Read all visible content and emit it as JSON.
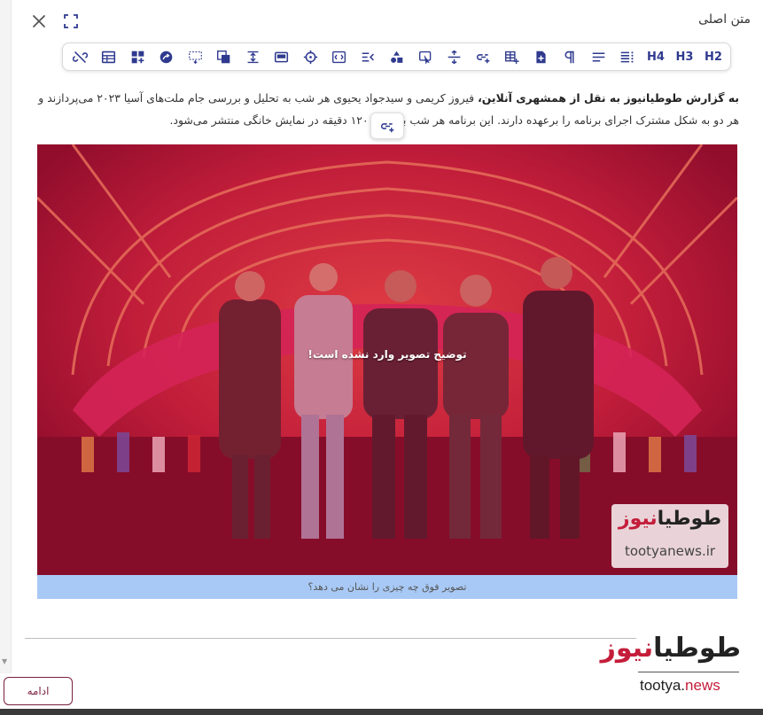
{
  "dialog": {
    "title": "متن اصلی",
    "close_icon": "close-icon",
    "expand_icon": "fullscreen-icon"
  },
  "toolbar": {
    "items": [
      {
        "name": "heading-2",
        "label": "H2"
      },
      {
        "name": "heading-3",
        "label": "H3"
      },
      {
        "name": "heading-4",
        "label": "H4"
      },
      {
        "name": "justify",
        "icon": "text-justify-icon"
      },
      {
        "name": "align",
        "icon": "text-align-icon"
      },
      {
        "name": "paragraph",
        "icon": "pilcrow-icon"
      },
      {
        "name": "add-file",
        "icon": "file-add-icon"
      },
      {
        "name": "insert-table",
        "icon": "table-add-icon"
      },
      {
        "name": "insert-link",
        "icon": "link-add-icon"
      },
      {
        "name": "strikethrough",
        "icon": "strikethrough-icon"
      },
      {
        "name": "insert-media",
        "icon": "media-icon"
      },
      {
        "name": "insert-shapes",
        "icon": "shapes-icon"
      },
      {
        "name": "text-direction",
        "icon": "text-direction-icon"
      },
      {
        "name": "code-block",
        "icon": "code-block-icon"
      },
      {
        "name": "center-target",
        "icon": "crosshair-icon"
      },
      {
        "name": "frame",
        "icon": "frame-icon"
      },
      {
        "name": "vertical-align",
        "icon": "vertical-align-icon"
      },
      {
        "name": "copy",
        "icon": "copy-icon"
      },
      {
        "name": "select-area",
        "icon": "select-area-icon"
      },
      {
        "name": "share",
        "icon": "share-icon"
      },
      {
        "name": "widgets",
        "icon": "widgets-add-icon"
      },
      {
        "name": "layout-table",
        "icon": "table-icon"
      },
      {
        "name": "unlink",
        "icon": "unlink-icon"
      }
    ]
  },
  "article": {
    "lead_bold": "به گزارش طوطیانیوز به نقل از همشهری آنلاین،",
    "body": "فیروز کریمی و سیدجواد یحیوی هر شب به تحلیل و بررسی جام ملت‌های آسیا ۲۰۲۳ می‌پردازند و هر دو به شکل مشترک اجرای برنامه را برعهده دارند. این برنامه هر شب به مدت ۱۲۰ دقیقه در نمایش خانگی منتشر می‌شود."
  },
  "image": {
    "missing_caption_text": "توضیح تصویر وارد نشده است!",
    "watermark_fa": "طوطیانیوز",
    "watermark_en": "tootyanews.ir",
    "overlay_color": "#c4143c"
  },
  "caption": {
    "placeholder": "تصویر فوق چه چیزی را نشان می دهد؟"
  },
  "footer": {
    "continue_label": "ادامه",
    "logo_fa_main": "طوطیا",
    "logo_fa_accent": "نیوز",
    "logo_en_main": "tootya.",
    "logo_en_accent": "news"
  },
  "colors": {
    "toolbar_icon": "#2f3a8f",
    "accent": "#c41d3a",
    "caption_bg": "#a8c9f5",
    "button_border": "#7a1f3d"
  }
}
